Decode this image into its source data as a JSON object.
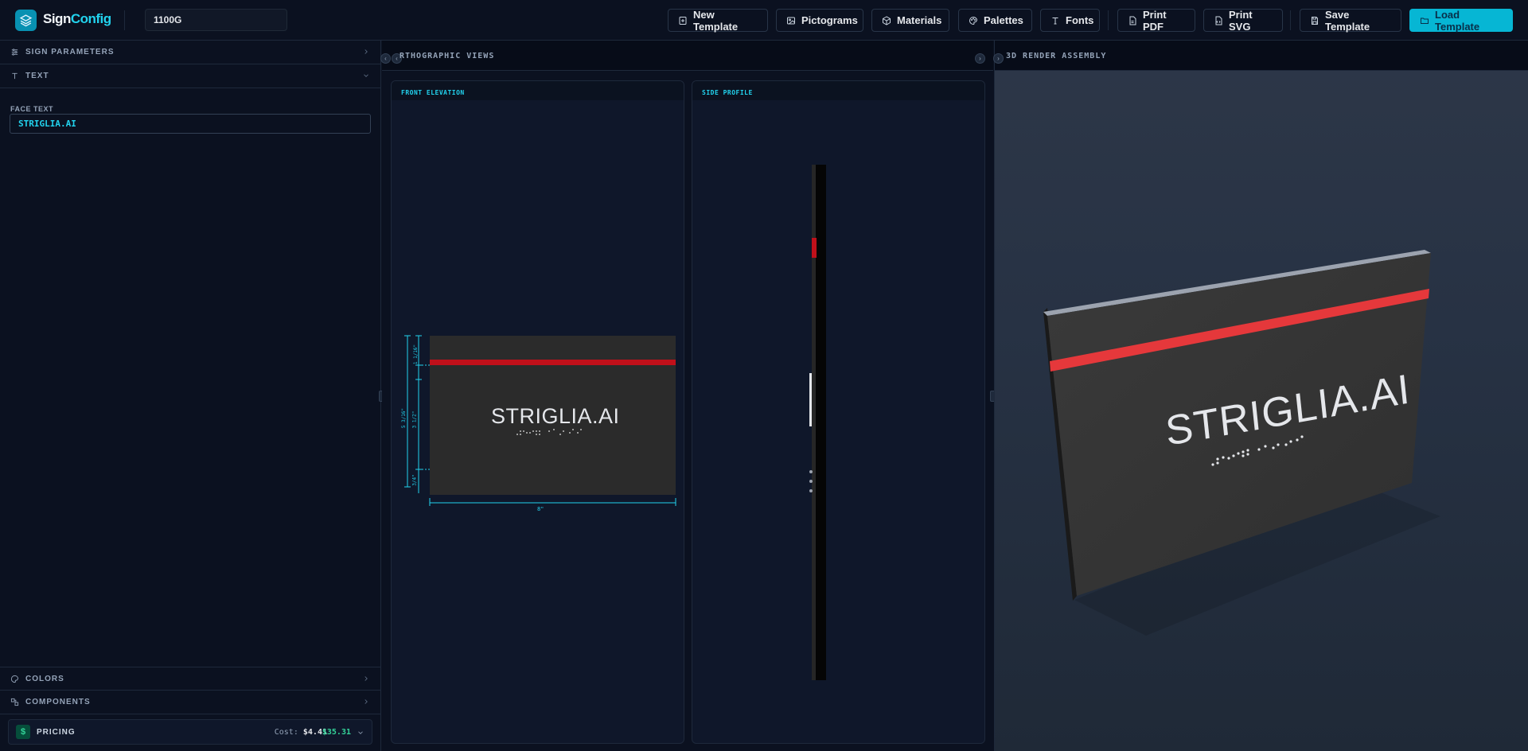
{
  "brand": {
    "part1": "Sign",
    "part2": "Config"
  },
  "template_name": "1100G",
  "toolbar": {
    "new_template": "New Template",
    "pictograms": "Pictograms",
    "materials": "Materials",
    "palettes": "Palettes",
    "fonts": "Fonts",
    "print_pdf": "Print PDF",
    "print_svg": "Print SVG",
    "save_template": "Save Template",
    "load_template": "Load Template"
  },
  "left": {
    "sections": {
      "sign_parameters": "SIGN PARAMETERS",
      "text": "TEXT",
      "colors": "COLORS",
      "components": "COMPONENTS"
    },
    "face_text_label": "FACE TEXT",
    "face_text_value": "STRIGLIA.AI",
    "pricing": {
      "label": "PRICING",
      "cost_label": "Cost:",
      "cost": "$4.41",
      "total": "$35.31"
    }
  },
  "views": {
    "ortho_title": "RTHOGRAPHIC VIEWS",
    "front_title": "FRONT ELEVATION",
    "side_title": "SIDE PROFILE",
    "render_title": "3D RENDER ASSEMBLY",
    "sign_text": "STRIGLIA.AI",
    "dims": {
      "width": "8\"",
      "height": "5 3/16\"",
      "inner": "3 1/2\"",
      "top": "1 1/16\"",
      "bottom": "3/4\""
    }
  },
  "colors": {
    "accent": "#06b6d4",
    "sign_face": "#2b2b2b",
    "stripe": "#c0101a",
    "money": "#34d399"
  }
}
